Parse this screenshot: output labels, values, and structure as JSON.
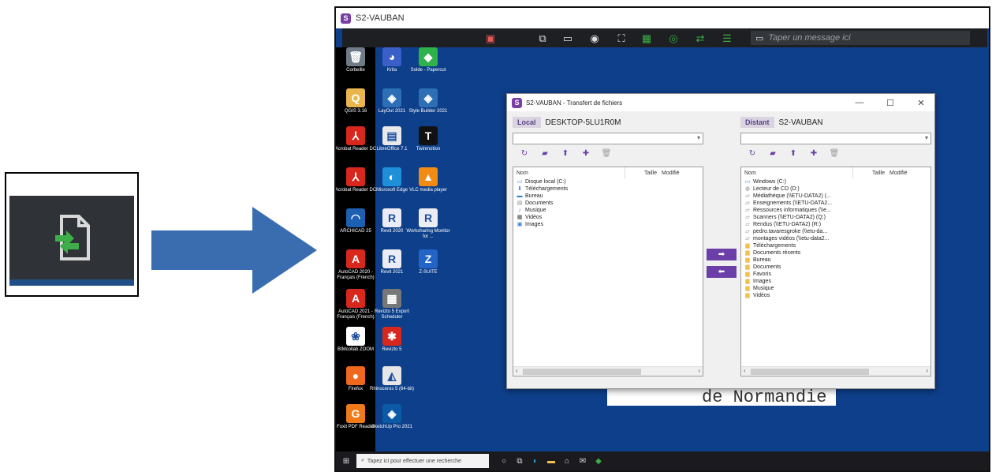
{
  "window_title": "S2-VAUBAN",
  "toolbar": {
    "message_placeholder": "Taper un message ici"
  },
  "desktop_icons": [
    {
      "label": "Corbeille",
      "icon": "recycle-bin-icon",
      "color": "#6f7b86"
    },
    {
      "label": "Krita",
      "icon": "krita-icon",
      "color": "#3b5fc9"
    },
    {
      "label": "Solde - Papercut",
      "icon": "papercut-icon",
      "color": "#2fb24a"
    },
    {
      "label": "QGIS 3.16",
      "icon": "qgis-icon",
      "color": "#e8b64c"
    },
    {
      "label": "LayOut 2021",
      "icon": "layout-icon",
      "color": "#2c6fb5"
    },
    {
      "label": "Style Builder 2021",
      "icon": "style-builder-icon",
      "color": "#2c6fb5"
    },
    {
      "label": "Acrobat Reader DC",
      "icon": "acrobat-icon",
      "color": "#d8271c"
    },
    {
      "label": "LibreOffice 7.1",
      "icon": "libreoffice-icon",
      "color": "#e9e9e9"
    },
    {
      "label": "Twinmotion",
      "icon": "twinmotion-icon",
      "color": "#111111"
    },
    {
      "label": "Acrobat Reader DC",
      "icon": "acrobat-icon",
      "color": "#d8271c"
    },
    {
      "label": "Microsoft Edge",
      "icon": "edge-icon",
      "color": "#1f8fd8"
    },
    {
      "label": "VLC media player",
      "icon": "vlc-icon",
      "color": "#f28b13"
    },
    {
      "label": "ARCHICAD 25",
      "icon": "archicad-icon",
      "color": "#1d5fb0"
    },
    {
      "label": "Revit 2020",
      "icon": "revit-icon",
      "color": "#ececf4"
    },
    {
      "label": "Worksharing Monitor for ...",
      "icon": "worksharing-icon",
      "color": "#ececf4"
    },
    {
      "label": "AutoCAD 2020 - Français (French)",
      "icon": "autocad-icon",
      "color": "#d8271c"
    },
    {
      "label": "Revit 2021",
      "icon": "revit-icon",
      "color": "#ececf4"
    },
    {
      "label": "Z-SUITE",
      "icon": "zsuite-icon",
      "color": "#2364c7"
    },
    {
      "label": "AutoCAD 2021 - Français (French)",
      "icon": "autocad-icon",
      "color": "#d8271c"
    },
    {
      "label": "Revizto 5 Export Scheduler",
      "icon": "revizto-scheduler-icon",
      "color": "#777777"
    },
    {
      "label": "BIMcollab ZOOM",
      "icon": "bimcollab-icon",
      "color": "#ffffff"
    },
    {
      "label": "Revizto 5",
      "icon": "revizto-icon",
      "color": "#d8271c"
    },
    {
      "label": "Firefox",
      "icon": "firefox-icon",
      "color": "#f0681e"
    },
    {
      "label": "Rhinoceros 5 (64-bit)",
      "icon": "rhino-icon",
      "color": "#e6e6e6"
    },
    {
      "label": "Foxit PDF Reader",
      "icon": "foxit-icon",
      "color": "#f07a1a"
    },
    {
      "label": "SketchUp Pro 2021",
      "icon": "sketchup-icon",
      "color": "#0c5aa6"
    }
  ],
  "background_text": "de Normandie",
  "file_transfer": {
    "title": "S2-VAUBAN - Transfert de fichiers",
    "local": {
      "tag": "Local",
      "host": "DESKTOP-5LU1R0M",
      "columns": {
        "name": "Nom",
        "size": "Taille",
        "modified": "Modifié"
      },
      "items": [
        {
          "label": "Disque local (C:)",
          "icon": "drive-icon"
        },
        {
          "label": "Téléchargements",
          "icon": "download-icon"
        },
        {
          "label": "Bureau",
          "icon": "desktop-folder-icon"
        },
        {
          "label": "Documents",
          "icon": "document-icon"
        },
        {
          "label": "Musique",
          "icon": "music-icon"
        },
        {
          "label": "Vidéos",
          "icon": "video-icon"
        },
        {
          "label": "Images",
          "icon": "image-icon"
        }
      ]
    },
    "remote": {
      "tag": "Distant",
      "host": "S2-VAUBAN",
      "columns": {
        "name": "Nom",
        "size": "Taille",
        "modified": "Modifié"
      },
      "items": [
        {
          "label": "Windows (C:)",
          "icon": "drive-icon"
        },
        {
          "label": "Lecteur de CD (D:)",
          "icon": "cd-drive-icon"
        },
        {
          "label": "Médiathèque (\\\\ETU-DATA2) (...",
          "icon": "network-drive-icon"
        },
        {
          "label": "Enseignements (\\\\ETU-DATA2...",
          "icon": "network-drive-icon"
        },
        {
          "label": "Ressources informatiques (\\\\e...",
          "icon": "network-drive-icon"
        },
        {
          "label": "Scanners (\\\\ETU-DATA2) (Q:)",
          "icon": "network-drive-icon"
        },
        {
          "label": "Rendus (\\\\ETU-DATA2) (R:)",
          "icon": "network-drive-icon"
        },
        {
          "label": "pedro.tavaresgroke (\\\\etu-da...",
          "icon": "network-drive-icon"
        },
        {
          "label": "montages vidéos (\\\\etu-data2...",
          "icon": "network-drive-icon"
        },
        {
          "label": "Téléchargements",
          "icon": "folder-icon"
        },
        {
          "label": "Documents récents",
          "icon": "folder-icon"
        },
        {
          "label": "Bureau",
          "icon": "folder-icon"
        },
        {
          "label": "Documents",
          "icon": "folder-icon"
        },
        {
          "label": "Favoris",
          "icon": "folder-icon"
        },
        {
          "label": "Images",
          "icon": "folder-icon"
        },
        {
          "label": "Musique",
          "icon": "folder-icon"
        },
        {
          "label": "Vidéos",
          "icon": "folder-icon"
        }
      ]
    }
  },
  "taskbar": {
    "search_placeholder": "Tapez ici pour effectuer une recherche"
  },
  "colors": {
    "accent": "#6c3fa8",
    "desktop": "#0e3f8a",
    "toolbar": "#1d1f22",
    "transfer_icon_green": "#3dae49"
  }
}
